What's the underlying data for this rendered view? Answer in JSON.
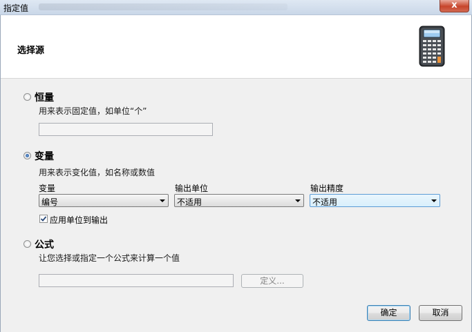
{
  "window": {
    "title": "指定值",
    "close_label": "x"
  },
  "header": {
    "title": "选择源",
    "icon": "calculator-icon"
  },
  "constant": {
    "label": "恒量",
    "description": "用来表示固定值，如单位“个”",
    "value": "",
    "selected": false
  },
  "variable": {
    "label": "变量",
    "description": "用来表示变化值，如名称或数值",
    "selected": true,
    "fields": [
      {
        "label": "变量",
        "value": "编号"
      },
      {
        "label": "输出单位",
        "value": "不适用"
      },
      {
        "label": "输出精度",
        "value": "不适用"
      }
    ],
    "apply_unit": {
      "label": "应用单位到输出",
      "checked": true
    }
  },
  "formula": {
    "label": "公式",
    "description": "让您选择或指定一个公式来计算一个值",
    "value": "",
    "define_label": "定义...",
    "selected": false
  },
  "buttons": {
    "ok": "确定",
    "cancel": "取消"
  }
}
